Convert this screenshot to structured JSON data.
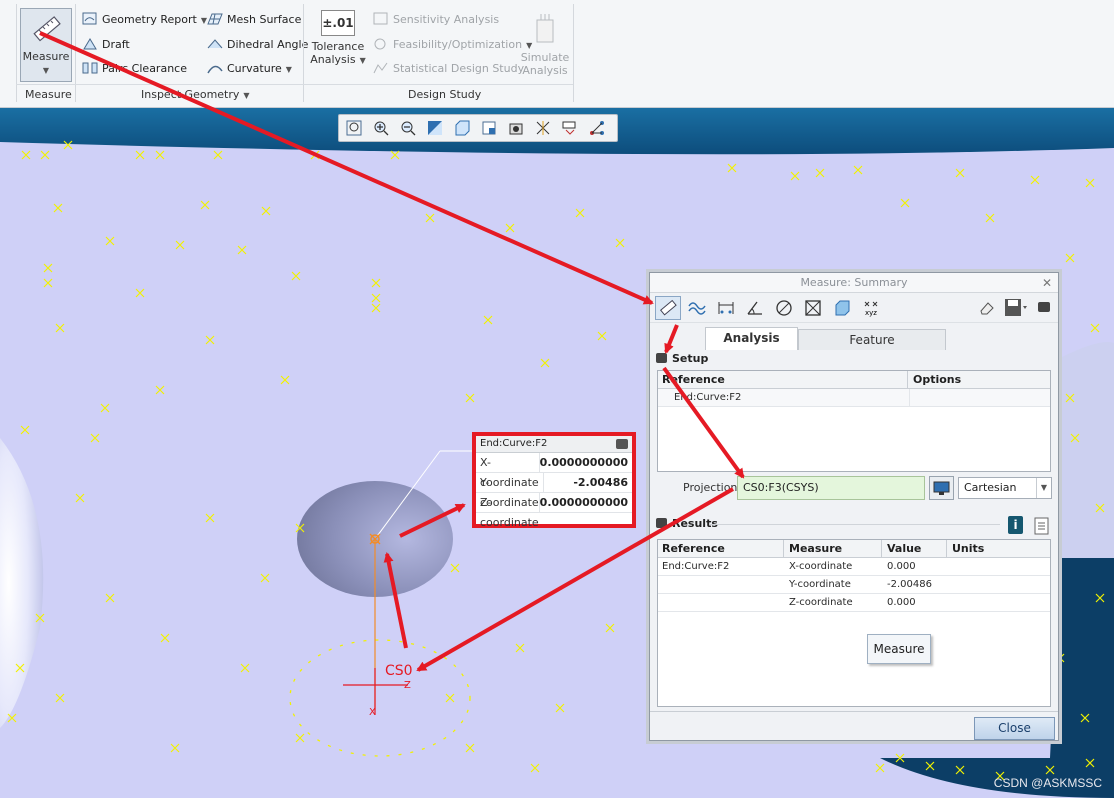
{
  "ribbon": {
    "measure_label": "Measure",
    "inspect_items": [
      {
        "label": "Geometry Report",
        "dropdown": true
      },
      {
        "label": "Draft",
        "dropdown": false
      },
      {
        "label": "Pairs Clearance",
        "dropdown": false
      },
      {
        "label": "Mesh Surface",
        "dropdown": false
      },
      {
        "label": "Dihedral Angle",
        "dropdown": false
      },
      {
        "label": "Curvature",
        "dropdown": true
      }
    ],
    "tolerance_label_1": "Tolerance",
    "tolerance_label_2": "Analysis",
    "tolerance_icon_text": "±.01",
    "design_items": [
      {
        "label": "Sensitivity Analysis"
      },
      {
        "label": "Feasibility/Optimization"
      },
      {
        "label": "Statistical Design Study"
      }
    ],
    "simulate_label_1": "Simulate",
    "simulate_label_2": "Analysis",
    "groups": {
      "measure": "Measure",
      "inspect": "Inspect Geometry",
      "design": "Design Study"
    }
  },
  "callout": {
    "title": "End:Curve:F2",
    "rows": [
      {
        "key": "X-coordinate",
        "value": "0.0000000000"
      },
      {
        "key": "Y-coordinate",
        "value": "-2.00486"
      },
      {
        "key": "Z-coordinate",
        "value": "0.0000000000"
      }
    ]
  },
  "csys_label": "CS0",
  "axis_z": "Z",
  "axis_x": "X",
  "dialog": {
    "title": "Measure: Summary",
    "tabs": [
      "Analysis",
      "Feature"
    ],
    "setup_label": "Setup",
    "setup_headers": [
      "Reference",
      "Options"
    ],
    "setup_rows": [
      [
        "End:Curve:F2",
        ""
      ]
    ],
    "projection_label": "Projection:",
    "projection_value": "CS0:F3(CSYS)",
    "coord_system": "Cartesian",
    "results_label": "Results",
    "results_headers": [
      "Reference",
      "Measure",
      "Value",
      "Units"
    ],
    "results_rows": [
      [
        "End:Curve:F2",
        "X-coordinate",
        "0.000",
        ""
      ],
      [
        "",
        "Y-coordinate",
        "-2.00486",
        ""
      ],
      [
        "",
        "Z-coordinate",
        "0.000",
        ""
      ]
    ],
    "measure_button": "Measure",
    "close_button": "Close"
  },
  "watermark": "CSDN @ASKMSSC",
  "colors": {
    "annotation": "#e51a24",
    "model_surface": "#cfd0f7",
    "dark_band": "#0f5a8c",
    "marker": "#f2f200"
  }
}
